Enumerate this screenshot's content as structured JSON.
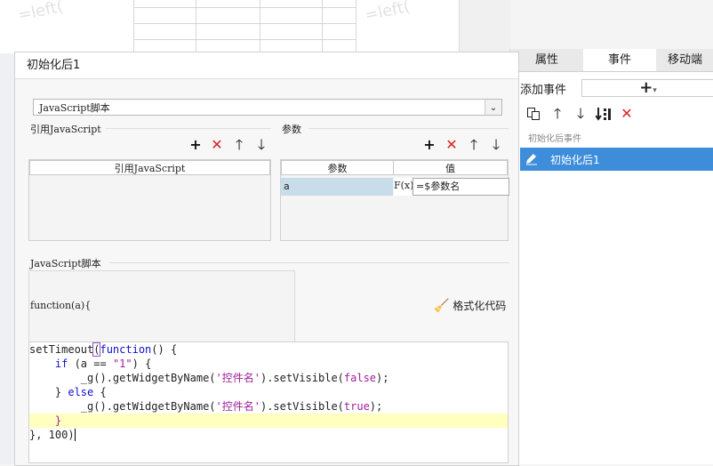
{
  "right_panel": {
    "tabs": [
      "属性",
      "事件",
      "移动端"
    ],
    "active_tab": 1,
    "add_event_label": "添加事件",
    "add_button_glyph": "+",
    "event_group_label": "初始化后事件",
    "events": [
      {
        "label": "初始化后1",
        "selected": true
      }
    ],
    "icons": [
      "copy-icon",
      "arrow-up-icon",
      "arrow-down-icon",
      "move-bottom-icon",
      "delete-icon"
    ]
  },
  "dialog": {
    "title": "初始化后1",
    "type_select": "JavaScript脚本",
    "ref_js": {
      "section_title": "引用JavaScript",
      "column_header": "引用JavaScript"
    },
    "params": {
      "section_title": "参数",
      "columns": [
        "参数",
        "值"
      ],
      "rows": [
        {
          "name": "a",
          "fx_label": "F(x)",
          "value": "=$参数名"
        }
      ]
    },
    "script": {
      "section_title": "JavaScript脚本",
      "function_signature": "function(a){",
      "format_button": "格式化代码"
    },
    "code_lines": [
      "setTimeout(function() {",
      "    if (a == \"1\") {",
      "        _g().getWidgetByName('控件名').setVisible(false);",
      "    } else {",
      "        _g().getWidgetByName('控件名').setVisible(true);",
      "    }",
      "}, 100)"
    ]
  },
  "background": {
    "watermark": "=left("
  }
}
